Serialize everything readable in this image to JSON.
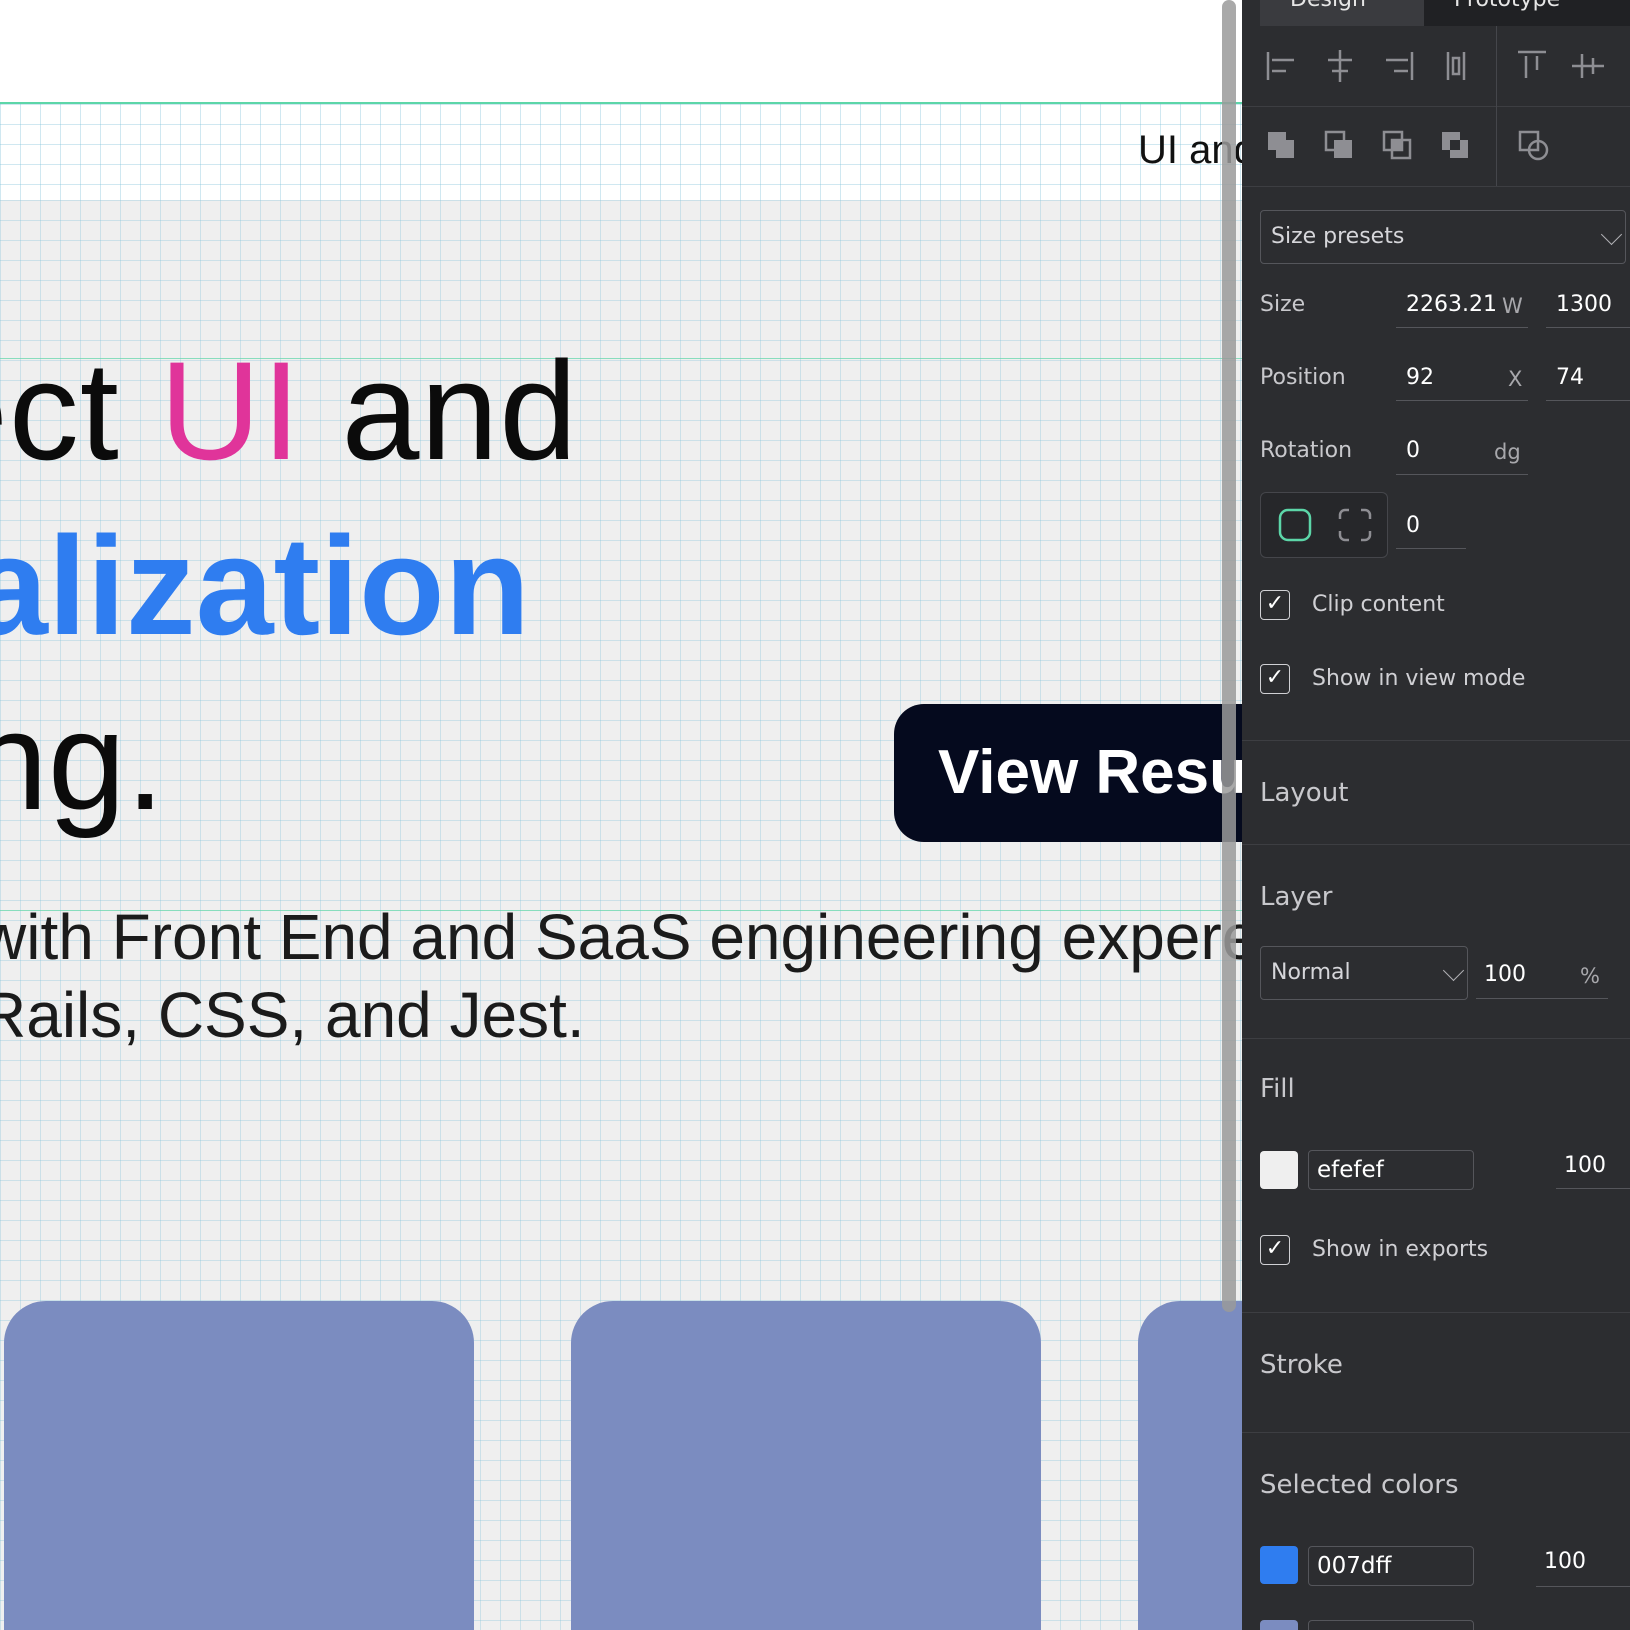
{
  "canvas": {
    "nav_text": "UI and",
    "hero": {
      "line1_pre": "ect ",
      "line1_accent": "UI",
      "line1_post": " and",
      "line2": "alization",
      "line3": "ng."
    },
    "cta_label": "View Resu",
    "subtitle_line1": "with Front End and SaaS engineering expereinc",
    "subtitle_line2": "Rails, CSS, and Jest.",
    "colors": {
      "accent_pink": "#e0349a",
      "accent_blue": "#2f7df0",
      "cta_bg": "#050a1e",
      "card": "#7b8cc0",
      "artboard_bg": "#efefef",
      "guide": "#5cd6a8"
    }
  },
  "panel": {
    "tabs": [
      "Design",
      "Prototype"
    ],
    "size_presets": "Size presets",
    "size": {
      "label": "Size",
      "w": "2263.21",
      "w_unit": "W",
      "h": "1300"
    },
    "position": {
      "label": "Position",
      "x": "92",
      "x_unit": "X",
      "y": "74"
    },
    "rotation": {
      "label": "Rotation",
      "value": "0",
      "unit": "dg"
    },
    "radius": {
      "value": "0"
    },
    "clip_content": {
      "label": "Clip content",
      "checked": true
    },
    "show_in_view_mode": {
      "label": "Show in view mode",
      "checked": true
    },
    "sections": {
      "layout": "Layout",
      "layer": "Layer",
      "fill": "Fill",
      "stroke": "Stroke",
      "selected_colors": "Selected colors"
    },
    "layer": {
      "blend": "Normal",
      "opacity": "100",
      "unit": "%"
    },
    "fill": {
      "hex": "efefef",
      "opacity": "100",
      "color": "#efefef"
    },
    "show_in_exports": {
      "label": "Show in exports",
      "checked": true
    },
    "selected_colors": [
      {
        "hex": "007dff",
        "opacity": "100",
        "color": "#2f7df0"
      }
    ],
    "icons": [
      "align-left-icon",
      "align-h-center-icon",
      "align-right-icon",
      "distribute-h-icon",
      "align-top-icon",
      "align-v-center-icon",
      "bool-union-icon",
      "bool-difference-icon",
      "bool-intersection-icon",
      "bool-exclude-icon",
      "flatten-icon",
      "radius-all-icon",
      "radius-independent-icon"
    ]
  }
}
